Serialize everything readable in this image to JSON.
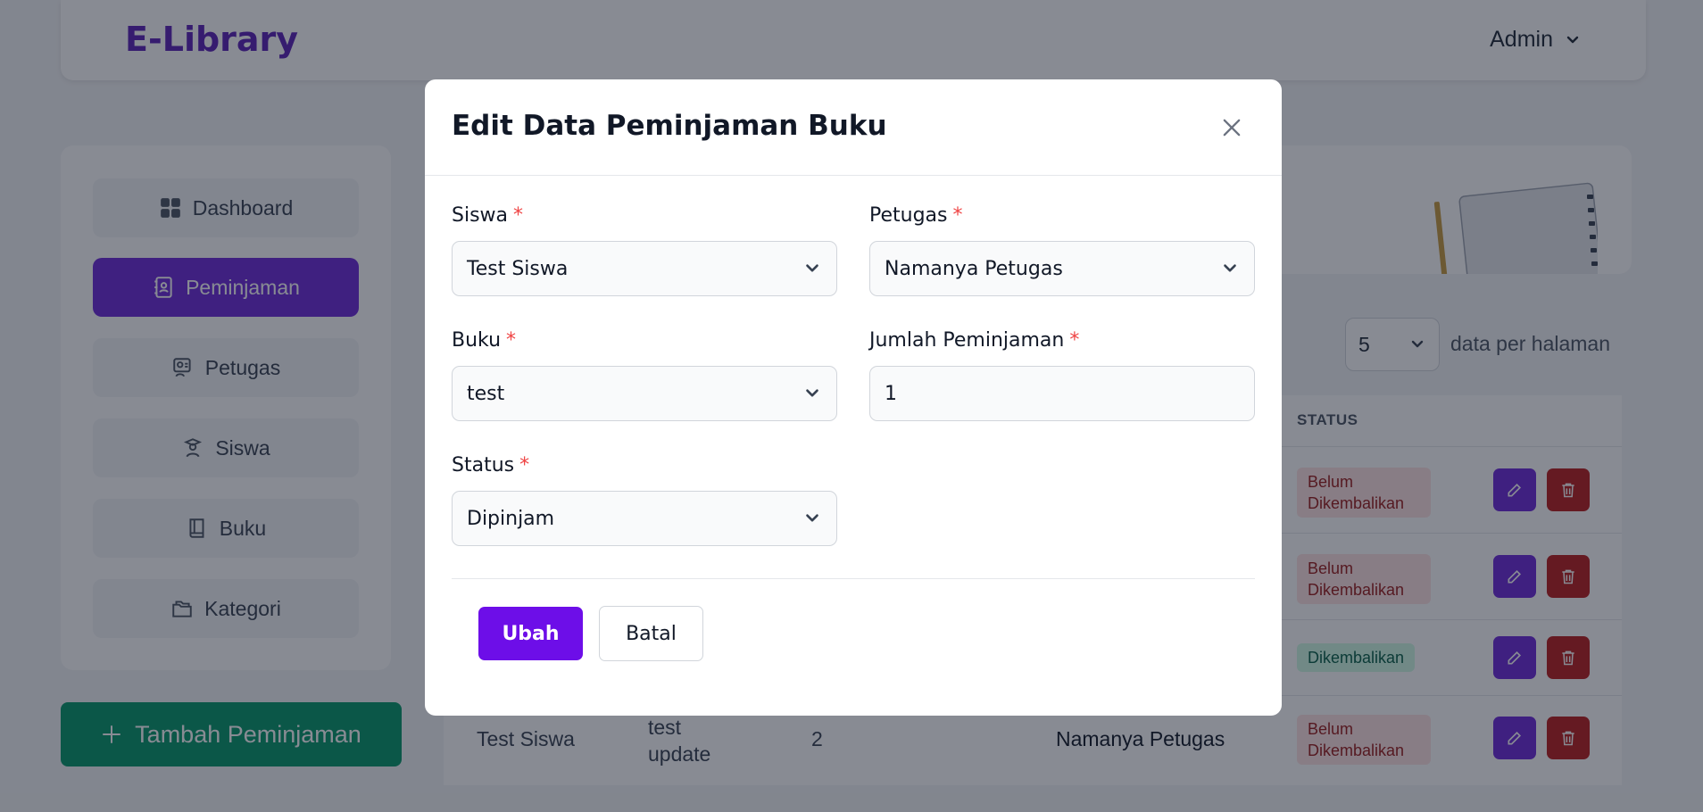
{
  "app": {
    "brand": "E-Library",
    "user_menu": "Admin"
  },
  "sidebar": {
    "items": [
      {
        "label": "Dashboard",
        "icon": "grid-icon"
      },
      {
        "label": "Peminjaman",
        "icon": "contact-book-icon",
        "active": true
      },
      {
        "label": "Petugas",
        "icon": "staff-icon"
      },
      {
        "label": "Siswa",
        "icon": "student-icon"
      },
      {
        "label": "Buku",
        "icon": "book-icon"
      },
      {
        "label": "Kategori",
        "icon": "folders-icon"
      }
    ],
    "add_button": "Tambah Peminjaman"
  },
  "table": {
    "per_page_value": "5",
    "per_page_label": "data per halaman",
    "status_header": "STATUS",
    "statuses": [
      "Belum Dikembalikan",
      "Belum Dikembalikan",
      "Dikembalikan",
      "Belum Dikembalikan"
    ],
    "last_row": {
      "siswa": "Test Siswa",
      "buku": "test update",
      "jumlah": "2",
      "petugas": "Namanya Petugas"
    }
  },
  "modal": {
    "title": "Edit Data Peminjaman Buku",
    "fields": {
      "siswa": {
        "label": "Siswa",
        "value": "Test Siswa"
      },
      "petugas": {
        "label": "Petugas",
        "value": "Namanya Petugas"
      },
      "buku": {
        "label": "Buku",
        "value": "test"
      },
      "jumlah": {
        "label": "Jumlah Peminjaman",
        "value": "1"
      },
      "status": {
        "label": "Status",
        "value": "Dipinjam"
      }
    },
    "required_marker": "*",
    "submit_label": "Ubah",
    "cancel_label": "Batal"
  },
  "colors": {
    "accent": "#6d28d9",
    "primary_button": "#6d0ee8",
    "add_button": "#059669",
    "danger": "#b91c1c"
  }
}
